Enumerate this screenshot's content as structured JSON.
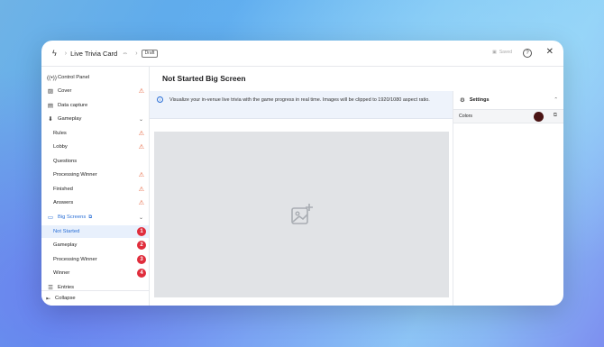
{
  "header": {
    "card_name": "Live Trivia Card",
    "status_badge": "Draft",
    "saved_label": "Saved",
    "help_label": "?",
    "close_label": "✕"
  },
  "sidebar": {
    "items": [
      {
        "label": "Control Panel",
        "icon": "broadcast-icon"
      },
      {
        "label": "Cover",
        "icon": "image-icon",
        "warning": true
      },
      {
        "label": "Data capture",
        "icon": "form-icon"
      },
      {
        "label": "Gameplay",
        "icon": "gamepad-icon",
        "expandable": true
      },
      {
        "label": "Rules",
        "warning": true
      },
      {
        "label": "Lobby",
        "warning": true
      },
      {
        "label": "Questions"
      },
      {
        "label": "Processing Winner",
        "warning": true
      },
      {
        "label": "Finished",
        "warning": true
      },
      {
        "label": "Answers",
        "warning": true
      },
      {
        "label": "Big Screens",
        "icon": "monitor-icon",
        "expandable": true
      },
      {
        "label": "Not Started",
        "badge": "1",
        "active": true
      },
      {
        "label": "Gameplay",
        "badge": "2"
      },
      {
        "label": "Processing Winner",
        "badge": "3"
      },
      {
        "label": "Winner",
        "badge": "4"
      },
      {
        "label": "Entries",
        "icon": "list-icon"
      }
    ],
    "collapse_label": "Collapse"
  },
  "main": {
    "title": "Not Started Big Screen",
    "info_text": "Visualize your in-venue live trivia with the game progress in real time. Images will be clipped to 1920/1080 aspect ratio."
  },
  "settings": {
    "title": "Settings",
    "colors_label": "Colors",
    "color_value": "#4a1414"
  },
  "colors": {
    "accent": "#2a6fd6",
    "warning": "#e4572e",
    "badge": "#e02d3c"
  }
}
